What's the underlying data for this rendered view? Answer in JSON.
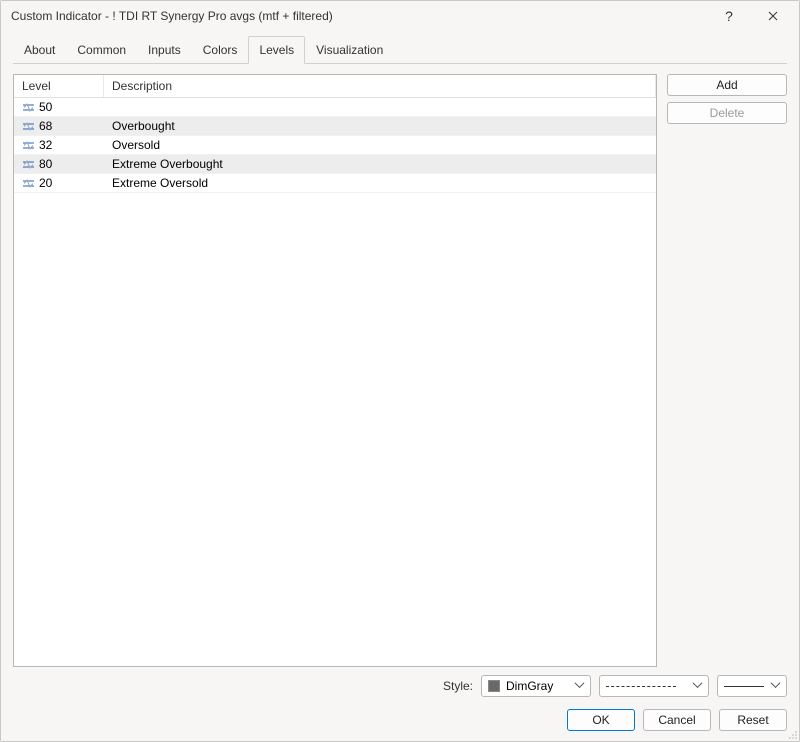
{
  "window": {
    "title": "Custom Indicator - ! TDI RT Synergy Pro avgs  (mtf + filtered)"
  },
  "tabs": [
    "About",
    "Common",
    "Inputs",
    "Colors",
    "Levels",
    "Visualization"
  ],
  "active_tab": "Levels",
  "columns": {
    "level": "Level",
    "desc": "Description"
  },
  "rows": [
    {
      "level": "50",
      "desc": ""
    },
    {
      "level": "68",
      "desc": "Overbought"
    },
    {
      "level": "32",
      "desc": "Oversold"
    },
    {
      "level": "80",
      "desc": "Extreme Overbought"
    },
    {
      "level": "20",
      "desc": "Extreme Oversold"
    }
  ],
  "side": {
    "add": "Add",
    "delete": "Delete"
  },
  "style": {
    "label": "Style:",
    "color_name": "DimGray",
    "color_hex": "#696969",
    "dash": "dashed",
    "width": "1"
  },
  "footer": {
    "ok": "OK",
    "cancel": "Cancel",
    "reset": "Reset"
  }
}
